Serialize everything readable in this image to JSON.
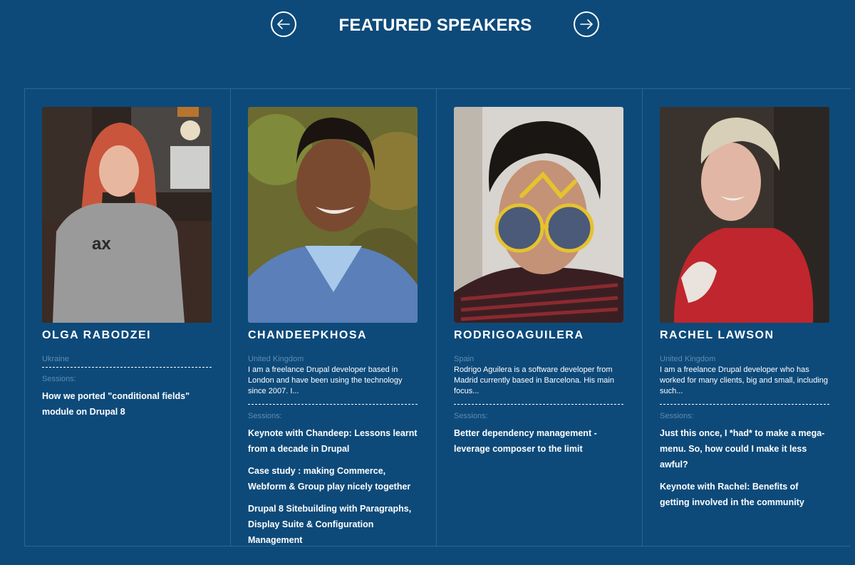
{
  "header": {
    "title": "FEATURED SPEAKERS",
    "prev_icon": "arrow-left-icon",
    "next_icon": "arrow-right-icon"
  },
  "labels": {
    "sessions": "Sessions:"
  },
  "speakers": [
    {
      "name": "OLGA RABODZEI",
      "country": "Ukraine",
      "bio": "",
      "sessions": [
        "How we ported \"conditional fields\" module on Drupal 8"
      ]
    },
    {
      "name": "CHANDEEPKHOSA",
      "country": "United Kingdom",
      "bio": "I am a freelance Drupal developer based in London and have been using the technology since 2007. I...",
      "sessions": [
        "Keynote with Chandeep: Lessons learnt from a decade in Drupal",
        "Case study : making Commerce, Webform & Group play nicely together",
        "Drupal 8 Sitebuilding with Paragraphs, Display Suite & Configuration Management"
      ]
    },
    {
      "name": "RODRIGOAGUILERA",
      "country": "Spain",
      "bio": "Rodrigo Aguilera is a software developer from Madrid currently based in Barcelona. His main focus...",
      "sessions": [
        "Better dependency management - leverage composer to the limit"
      ]
    },
    {
      "name": "RACHEL LAWSON",
      "country": "United Kingdom",
      "bio": "I am a freelance Drupal developer who has worked for many clients, big and small, including such...",
      "sessions": [
        "Just this once, I *had* to make a mega-menu. So, how could I make it less awful?",
        "Keynote with Rachel: Benefits of getting involved in the community"
      ]
    }
  ]
}
